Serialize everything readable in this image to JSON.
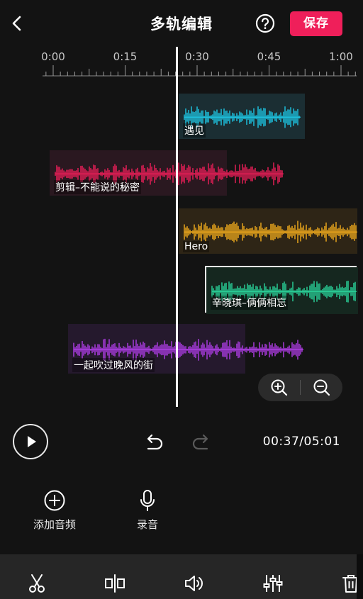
{
  "header": {
    "title": "多轨编辑",
    "save_label": "保存"
  },
  "ruler": {
    "labels": [
      "0:00",
      "0:15",
      "0:30",
      "0:45",
      "1:00"
    ]
  },
  "tracks": [
    {
      "name": "遇见",
      "color": "#1ec8e6",
      "bg": "#1b2e33",
      "selected": false
    },
    {
      "name": "剪辑–不能说的秘密",
      "color": "#ef1f5a",
      "bg": "#2a1820",
      "selected": false
    },
    {
      "name": "Hero",
      "color": "#f4ad1c",
      "bg": "#2e2516",
      "selected": false
    },
    {
      "name": "辛晓琪–俩俩相忘",
      "color": "#2ad69c",
      "bg": "#15271f",
      "selected": true
    },
    {
      "name": "一起吹过晚风的街",
      "color": "#b13ee8",
      "bg": "#25192d",
      "selected": false
    }
  ],
  "player": {
    "time": "00:37/05:01"
  },
  "tools": [
    {
      "label": "添加音频",
      "icon": "add-circle-icon"
    },
    {
      "label": "录音",
      "icon": "microphone-icon"
    }
  ],
  "bottom_bar": {
    "icons": [
      "scissors-icon",
      "split-icon",
      "volume-icon",
      "mixer-icon",
      "trash-icon"
    ]
  },
  "colors": {
    "accent": "#ef1f5a",
    "background": "#131313",
    "bar": "#262626"
  }
}
